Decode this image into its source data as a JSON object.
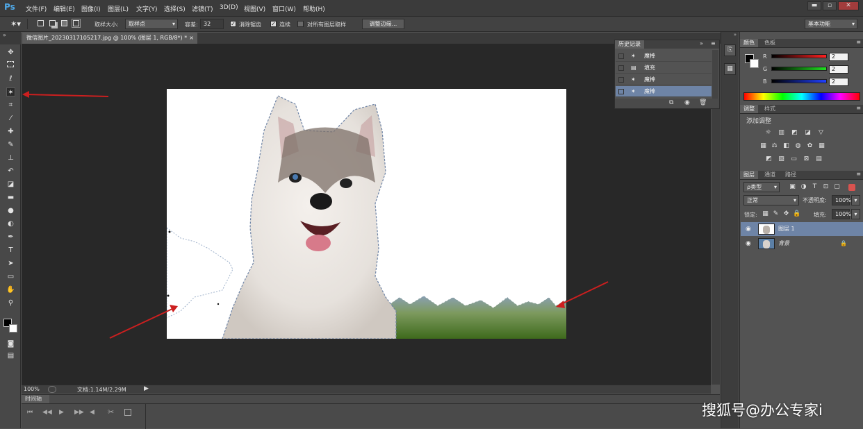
{
  "app": {
    "logo": "Ps"
  },
  "menu": [
    "文件(F)",
    "编辑(E)",
    "图像(I)",
    "图层(L)",
    "文字(Y)",
    "选择(S)",
    "滤镜(T)",
    "3D(D)",
    "视图(V)",
    "窗口(W)",
    "帮助(H)"
  ],
  "window_controls": {
    "minimize": "▬",
    "restore": "▫",
    "close": "✕"
  },
  "options": {
    "sample_size_label": "取样大小:",
    "sample_size_value": "取样点",
    "tolerance_label": "容差:",
    "tolerance_value": "32",
    "anti_alias_label": "消除锯齿",
    "anti_alias_checked": true,
    "contiguous_label": "连续",
    "contiguous_checked": true,
    "all_layers_label": "对所有图层取样",
    "all_layers_checked": false,
    "refine_edge_label": "调整边缘...",
    "workspace_value": "基本功能"
  },
  "document": {
    "tab_title": "微信图片_20230317105217.jpg @ 100% (图层 1, RGB/8*) *",
    "close": "×"
  },
  "status": {
    "zoom": "100%",
    "doc_info": "文档:1.14M/2.29M"
  },
  "timeline": {
    "label": "时间轴"
  },
  "history": {
    "title": "历史记录",
    "items": [
      {
        "label": "魔棒",
        "icon": "magic-wand-icon"
      },
      {
        "label": "填充",
        "icon": "fill-icon"
      },
      {
        "label": "魔棒",
        "icon": "magic-wand-icon"
      },
      {
        "label": "魔棒",
        "icon": "magic-wand-icon"
      }
    ],
    "selected_index": 3
  },
  "color_panel": {
    "tabs": [
      "颜色",
      "色板"
    ],
    "channels": [
      {
        "label": "R",
        "value": "2",
        "color": "#e03030"
      },
      {
        "label": "G",
        "value": "2",
        "color": "#30c030"
      },
      {
        "label": "B",
        "value": "2",
        "color": "#3050e0"
      }
    ]
  },
  "adjust_panel": {
    "tabs": [
      "调整",
      "样式"
    ],
    "title": "添加调整"
  },
  "layers_panel": {
    "tabs": [
      "图层",
      "通道",
      "路径"
    ],
    "filter_kind": "ρ类型",
    "blend_mode": "正常",
    "opacity_label": "不透明度:",
    "opacity_value": "100%",
    "lock_label": "锁定:",
    "fill_label": "填充:",
    "fill_value": "100%",
    "layers": [
      {
        "name": "图层 1",
        "selected": true,
        "locked": false
      },
      {
        "name": "背景",
        "selected": false,
        "locked": true
      }
    ]
  },
  "watermark": "搜狐号@办公专家i",
  "colors": {
    "accent_red": "#cc1f1f",
    "selection_blue": "#6e84a6"
  }
}
